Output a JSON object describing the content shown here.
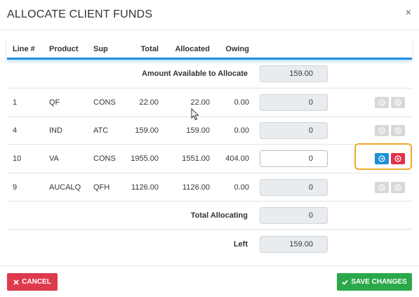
{
  "modal": {
    "title": "ALLOCATE CLIENT FUNDS",
    "close": "×"
  },
  "columns": {
    "line": "Line #",
    "product": "Product",
    "sup": "Sup",
    "total": "Total",
    "allocated": "Allocated",
    "owing": "Owing"
  },
  "available": {
    "label": "Amount Available to Allocate",
    "value": "159.00"
  },
  "rows": [
    {
      "line": "1",
      "product": "QF",
      "sup": "CONS",
      "total": "22.00",
      "allocated": "22.00",
      "owing": "0.00",
      "amount": "0"
    },
    {
      "line": "4",
      "product": "IND",
      "sup": "ATC",
      "total": "159.00",
      "allocated": "159.00",
      "owing": "0.00",
      "amount": "0"
    },
    {
      "line": "10",
      "product": "VA",
      "sup": "CONS",
      "total": "1955.00",
      "allocated": "1551.00",
      "owing": "404.00",
      "amount": "0"
    },
    {
      "line": "9",
      "product": "AUCALQ",
      "sup": "QFH",
      "total": "1126.00",
      "allocated": "1126.00",
      "owing": "0.00",
      "amount": "0"
    }
  ],
  "totals": {
    "allocating_label": "Total Allocating",
    "allocating_value": "0",
    "left_label": "Left",
    "left_value": "159.00"
  },
  "buttons": {
    "cancel": "CANCEL",
    "save": "SAVE CHANGES"
  },
  "colors": {
    "accent": "#1e90e0",
    "cancel": "#de3a4e",
    "save": "#2aa84a",
    "highlight": "#f0a92a",
    "disabled_button": "#d8d8d8"
  },
  "icons": {
    "close": "close-icon",
    "allocate": "arrow-circle-icon",
    "clear": "x-circle-icon",
    "cancel": "times-icon",
    "save": "check-icon"
  }
}
